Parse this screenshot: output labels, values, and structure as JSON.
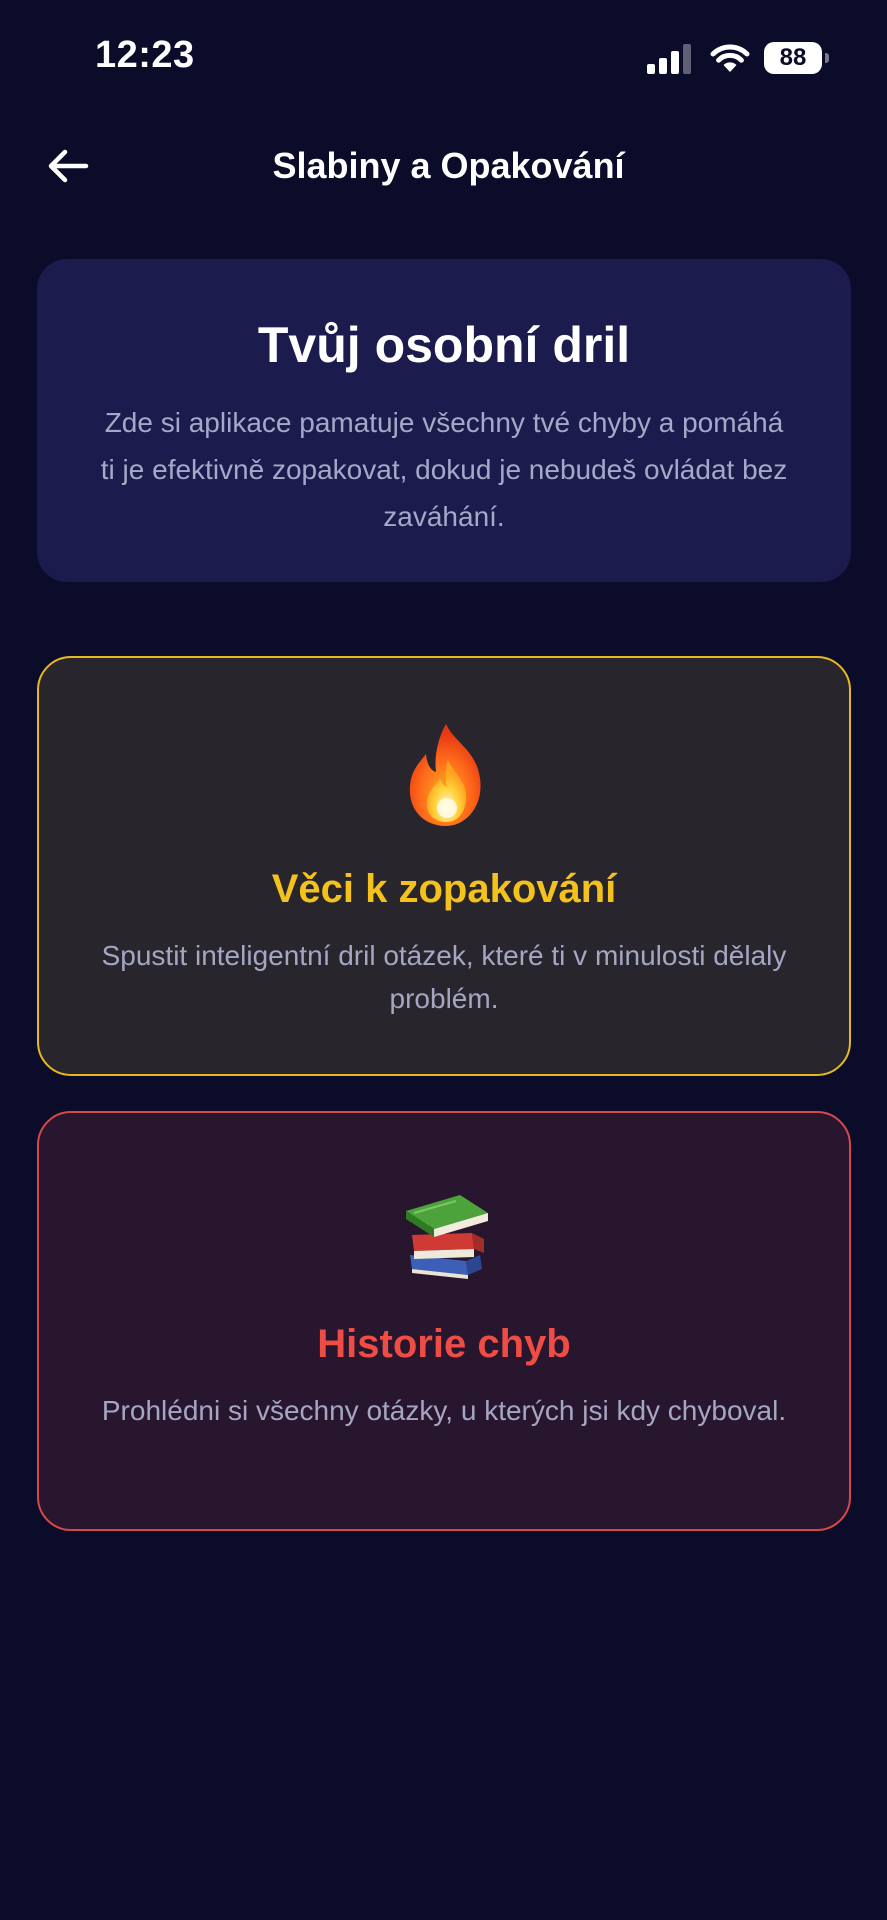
{
  "status_bar": {
    "time": "12:23",
    "battery_level": "88",
    "icons": [
      "signal-icon",
      "wifi-icon",
      "battery-icon"
    ]
  },
  "header": {
    "back_icon": "arrow-left-icon",
    "title": "Slabiny a Opakování"
  },
  "intro": {
    "title": "Tvůj osobní dril",
    "text": "Zde si aplikace pamatuje všechny tvé chyby a pomáhá ti je efektivně zopakovat, dokud je nebudeš ovládat bez zaváhání."
  },
  "cards": [
    {
      "icon": "fire-icon",
      "title": "Věci k zopakování",
      "description": "Spustit inteligentní dril otázek, které ti v minulosti dělaly problém.",
      "accent_color": "#f4c21d",
      "border_color": "#e6b81f"
    },
    {
      "icon": "books-icon",
      "title": "Historie chyb",
      "description": "Prohlédni si všechny otázky, u kterých jsi kdy chyboval.",
      "accent_color": "#ef4c45",
      "border_color": "#d74848"
    }
  ],
  "colors": {
    "background": "#0b0b2a",
    "intro_card": "#1b1b4d",
    "muted_text": "#a7a8c8"
  }
}
